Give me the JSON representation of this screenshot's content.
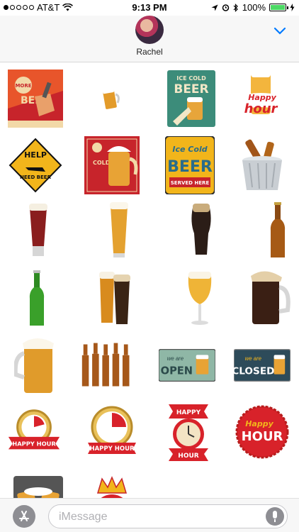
{
  "status_bar": {
    "carrier": "AT&T",
    "time": "9:13 PM",
    "battery": "100%",
    "signal_bars_filled": 1,
    "signal_bars_total": 5
  },
  "conversation": {
    "contact_name": "Rachel"
  },
  "stickers": {
    "row1": {
      "poster_more": "MORE",
      "poster_beer": "BEER",
      "icecold_top": "ICE COLD",
      "icecold_beer": "BEER",
      "happy": "Happy",
      "hour": "hour"
    },
    "row2": {
      "help": "HELP",
      "need_beer": "NEED BEER",
      "cold_beer_vert": "COLD BEER",
      "ice_cold": "Ice Cold",
      "beer": "BEER",
      "served_here": "SERVED HERE"
    },
    "row5": {
      "we_are": "we are",
      "open": "OPEN",
      "we_are_2": "we are",
      "closed": "CLOSED"
    },
    "row6": {
      "happy_hour_1": "HAPPY HOUR",
      "happy_hour_2": "HAPPY HOUR",
      "happy": "HAPPY",
      "hour": "HOUR",
      "happy_script": "Happy",
      "hour_big": "HOUR"
    }
  },
  "input": {
    "placeholder": "iMessage"
  },
  "colors": {
    "ios_blue": "#007aff",
    "battery_green": "#4cd964",
    "sticker_red": "#d8222a",
    "beer_amber": "#d98a1c"
  }
}
